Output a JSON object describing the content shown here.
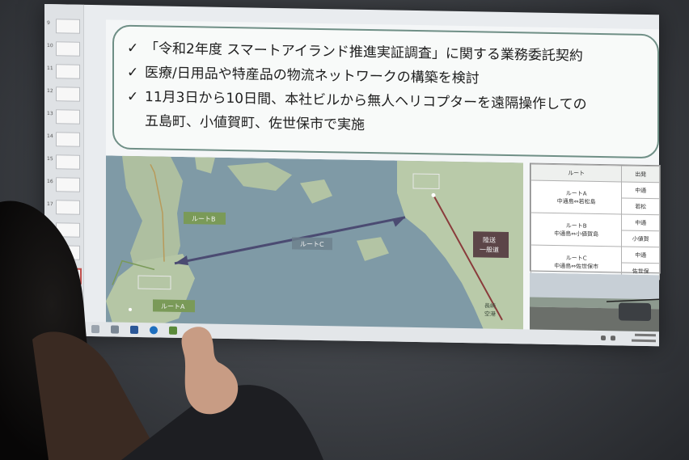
{
  "slide": {
    "bullets": [
      "「令和2年度 スマートアイランド推進実証調査」に関する業務委託契約",
      "医療/日用品や特産品の物流ネットワークの構築を検討",
      "11月3日から10日間、本社ビルから無人ヘリコプターを遠隔操作しての",
      "五島町、小値賀町、佐世保市で実施"
    ],
    "check_mark": "✓"
  },
  "map": {
    "route_a": "ルートA",
    "route_b": "ルートB",
    "route_c": "ルートC",
    "land_transport": [
      "陸送",
      "一般道"
    ],
    "airport": [
      "長崎",
      "空港"
    ],
    "colors": {
      "sea": "#7f9aa6",
      "land": "#b7c8a8",
      "route_label": "#7a9a58",
      "arrow": "#4b4b72",
      "land_label": "#5c4548"
    }
  },
  "table": {
    "header": [
      "ルート",
      "出発"
    ],
    "rows": [
      {
        "route": "ルートA",
        "sub": "中通島⇔若松島",
        "dep": [
          "中通",
          "若松"
        ]
      },
      {
        "route": "ルートB",
        "sub": "中通島⇔小値賀島",
        "dep": [
          "中通",
          "小値賀"
        ]
      },
      {
        "route": "ルートC",
        "sub": "中通島⇔佐世保市",
        "dep": [
          "中通",
          "佐世保"
        ]
      }
    ]
  }
}
